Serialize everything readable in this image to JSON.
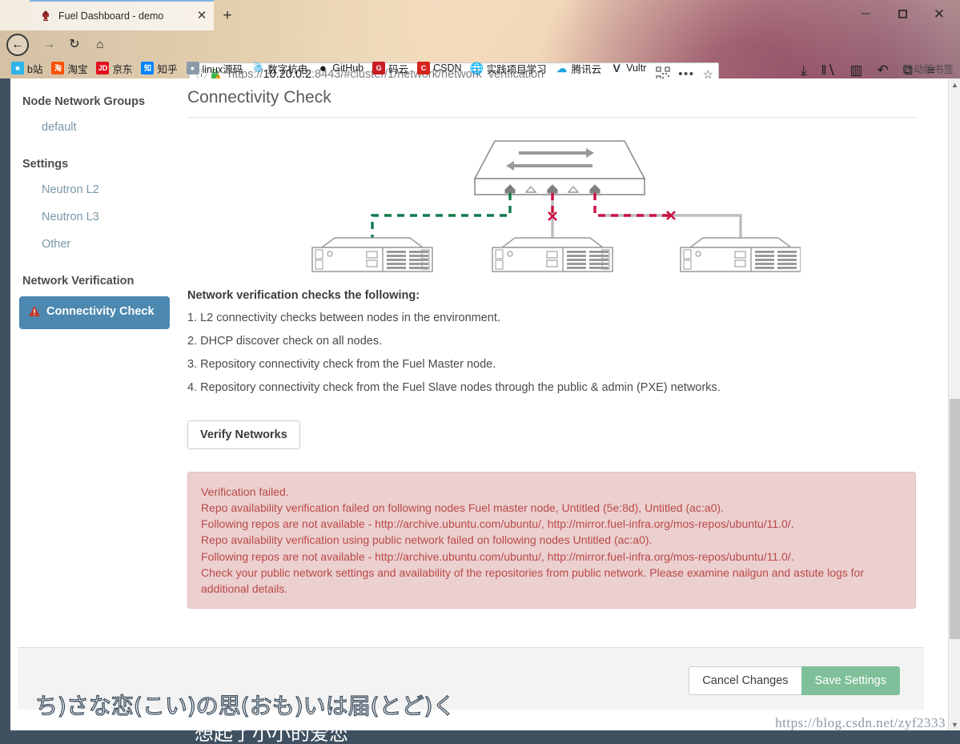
{
  "browser": {
    "tab": {
      "title": "Fuel Dashboard - demo",
      "favicon": "fuel-logo-icon",
      "close_label": "✕"
    },
    "new_tab_label": "+",
    "window_controls": {
      "minimize": "minimize-icon",
      "maximize": "maximize-icon",
      "close": "✕"
    },
    "nav": {
      "back": "←",
      "forward": "→",
      "reload": "↻",
      "home": "⌂"
    },
    "url": {
      "info_icon": "ⓘ",
      "lock_icon": "padlock-warning-icon",
      "scheme": "https://",
      "host": "10.20.0.2",
      "rest": ":8443/#cluster/1/network/network_verification",
      "qr_icon": "qr-code-icon",
      "more_icon": "•••",
      "star_icon": "☆"
    },
    "toolbar_right": [
      {
        "name": "downloads-icon",
        "glyph": "⤓"
      },
      {
        "name": "library-icon",
        "glyph": "‖∖"
      },
      {
        "name": "sidebar-icon",
        "glyph": "▥"
      },
      {
        "name": "sync-icon",
        "glyph": "↶"
      },
      {
        "name": "screenshot-icon",
        "glyph": "⧉"
      },
      {
        "name": "menu-icon",
        "glyph": "≡"
      }
    ],
    "bookmarks": [
      {
        "label": "b站",
        "icon_text": "■",
        "icon_color": "#2db4e8"
      },
      {
        "label": "淘宝",
        "icon_text": "淘",
        "icon_color": "#ff5000"
      },
      {
        "label": "京东",
        "icon_text": "JD",
        "icon_color": "#e3101e"
      },
      {
        "label": "知乎",
        "icon_text": "知",
        "icon_color": "#0084ff"
      },
      {
        "label": "linux源码",
        "icon_text": "●",
        "icon_color": "#8a9aa8"
      },
      {
        "label": "数字杭电",
        "icon_text": "☂",
        "icon_color": "#33b0e0"
      },
      {
        "label": "GitHub",
        "icon_text": "●",
        "icon_color": "#1b1f23"
      },
      {
        "label": "码云",
        "icon_text": "G",
        "icon_color": "#c71d23"
      },
      {
        "label": "CSDN",
        "icon_text": "C",
        "icon_color": "#d8241c"
      },
      {
        "label": "实践项目学习",
        "icon_text": "⊕",
        "icon_color": "#6b7c8c"
      },
      {
        "label": "腾讯云",
        "icon_text": "△",
        "icon_color": "#1aa3e0"
      },
      {
        "label": "Vultr",
        "icon_text": "V",
        "icon_color": "#2f3a44"
      }
    ],
    "bookmarks_overflow": "移动版书签"
  },
  "sidebar": {
    "groups": [
      {
        "heading": "Node Network Groups",
        "items": [
          "default"
        ]
      },
      {
        "heading": "Settings",
        "items": [
          "Neutron L2",
          "Neutron L3",
          "Other"
        ]
      },
      {
        "heading": "Network Verification",
        "items": []
      }
    ],
    "active_item": {
      "label": "Connectivity Check",
      "warning_icon": "warning-triangle-icon"
    }
  },
  "main": {
    "title": "Connectivity Check",
    "checks_heading": "Network verification checks the following:",
    "checks": [
      "1. L2 connectivity checks between nodes in the environment.",
      "2. DHCP discover check on all nodes.",
      "3. Repository connectivity check from the Fuel Master node.",
      "4. Repository connectivity check from the Fuel Slave nodes through the public & admin (PXE) networks."
    ],
    "verify_button": "Verify Networks",
    "alert": {
      "lines": [
        "Verification failed.",
        "Repo availability verification failed on following nodes Fuel master node, Untitled (5e:8d), Untitled (ac:a0).",
        "Following repos are not available - http://archive.ubuntu.com/ubuntu/, http://mirror.fuel-infra.org/mos-repos/ubuntu/11.0/.",
        "Repo availability verification using public network failed on following nodes Untitled (ac:a0).",
        "Following repos are not available - http://archive.ubuntu.com/ubuntu/, http://mirror.fuel-infra.org/mos-repos/ubuntu/11.0/.",
        "Check your public network settings and availability of the repositories from public network. Please examine nailgun and astute logs for additional details."
      ],
      "text_color": "#b94a48",
      "background_color": "#eccfcf"
    }
  },
  "footer": {
    "cancel_label": "Cancel Changes",
    "save_label": "Save Settings",
    "save_color": "#7fc09a"
  },
  "scrollbar": {
    "up": "▲",
    "down": "▼"
  },
  "overlay": {
    "subtitle_jp": "ち)さな恋(こい)の思(おも)いは届(とど)く",
    "subtitle_cn": "想起了小小的爱恋",
    "watermark": "https://blog.csdn.net/zyf2333"
  }
}
